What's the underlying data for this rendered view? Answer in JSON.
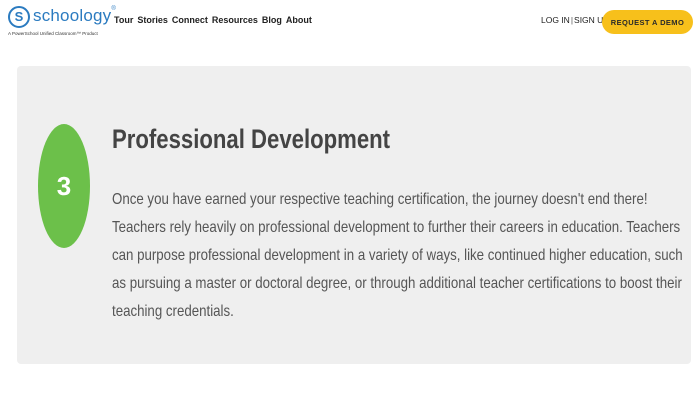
{
  "brand": {
    "mark": "S",
    "name": "schoology",
    "tm": "®",
    "tagline": "A PowerSchool Unified Classroom™ Product"
  },
  "nav": {
    "items": [
      {
        "label": "Tour"
      },
      {
        "label": "Stories"
      },
      {
        "label": "Connect"
      },
      {
        "label": "Resources"
      },
      {
        "label": "Blog"
      },
      {
        "label": "About"
      }
    ]
  },
  "auth": {
    "login": "LOG IN",
    "separator": "|",
    "signup": "SIGN UP"
  },
  "cta": {
    "label": "REQUEST A DEMO"
  },
  "card": {
    "step": "3",
    "title": "Professional Development",
    "body": "Once you have earned your respective teaching certification, the journey doesn't end there! Teachers rely heavily on professional development to further their careers in education. Teachers can purpose professional development in a variety of ways, like continued higher education, such as pursuing a master or doctoral degree, or through additional teacher certifications to boost their teaching credentials."
  },
  "colors": {
    "brand_blue": "#2b7bc0",
    "cta_yellow": "#f7c01b",
    "step_green": "#6cc04a",
    "card_bg": "#efefef"
  }
}
